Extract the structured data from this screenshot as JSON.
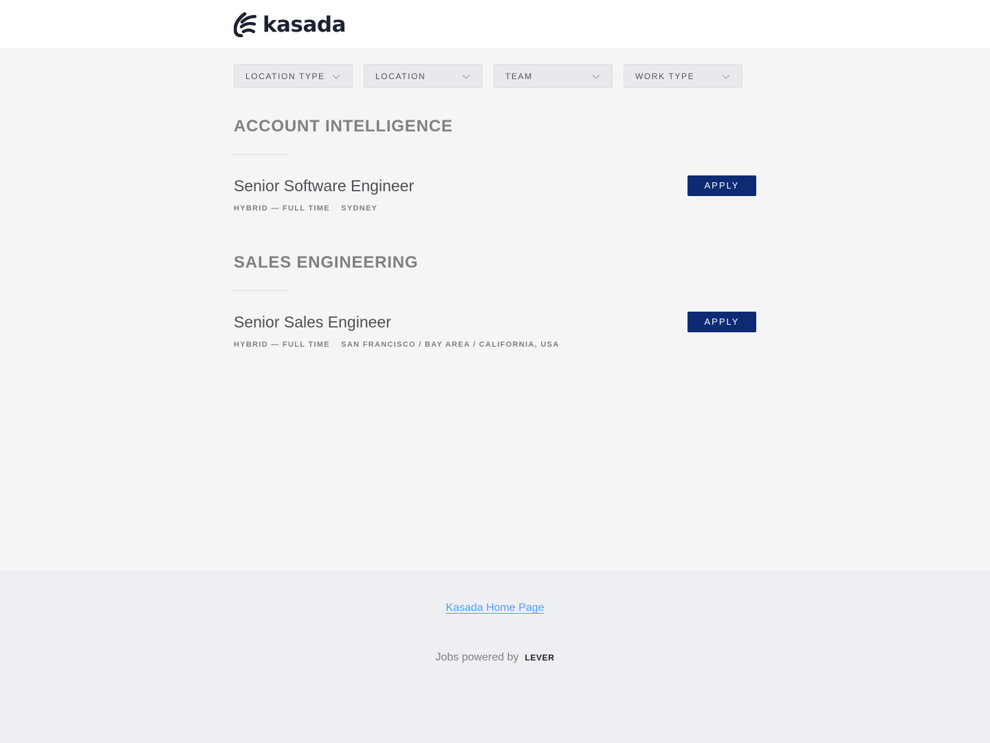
{
  "brand": {
    "name": "kasada"
  },
  "filters": [
    {
      "label": "LOCATION TYPE"
    },
    {
      "label": "LOCATION"
    },
    {
      "label": "TEAM"
    },
    {
      "label": "WORK TYPE"
    }
  ],
  "icons": {
    "logo": "kasada-logo-icon",
    "filter_toggle": "chevron-down-icon"
  },
  "colors": {
    "apply_bg": "#0c2b73",
    "link": "#579eee",
    "page_bg": "#f5f5f6"
  },
  "sections": [
    {
      "title": "ACCOUNT INTELLIGENCE",
      "jobs": [
        {
          "title": "Senior Software Engineer",
          "commitment": "HYBRID — FULL TIME",
          "location": "SYDNEY",
          "apply_label": "APPLY"
        }
      ]
    },
    {
      "title": "SALES ENGINEERING",
      "jobs": [
        {
          "title": "Senior Sales Engineer",
          "commitment": "HYBRID — FULL TIME",
          "location": "SAN FRANCISCO / BAY AREA / CALIFORNIA, USA",
          "apply_label": "APPLY"
        }
      ]
    }
  ],
  "footer": {
    "home_link": "Kasada Home Page",
    "powered_by": "Jobs powered by",
    "lever": "LEVER"
  }
}
